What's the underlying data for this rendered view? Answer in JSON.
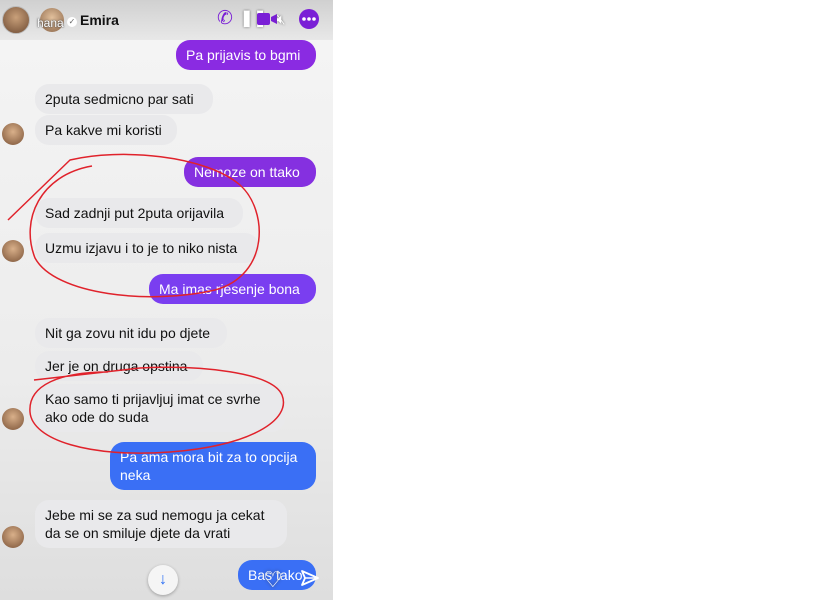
{
  "story": {
    "username": "hana",
    "contact_name": "Emira"
  },
  "icons": {
    "call": "phone-icon",
    "video": "video-icon",
    "mute": "mute-icon",
    "more": "more-icon",
    "pause": "pause-icon",
    "scroll_down": "arrow-down-icon",
    "like": "heart-icon",
    "share": "send-icon"
  },
  "colors": {
    "outgoing_purple": "#8a2be2",
    "outgoing_blue": "#3a6ff5",
    "annotation_red": "#e0222b"
  },
  "messages": [
    {
      "side": "out",
      "text": "Pa prijavis to bgmi"
    },
    {
      "side": "in",
      "text": "2puta sedmicno par sati"
    },
    {
      "side": "in",
      "text": "Pa kakve mi koristi"
    },
    {
      "side": "out",
      "text": "Nemoze on ttako"
    },
    {
      "side": "in",
      "text": "Sad zadnji put 2puta orijavila"
    },
    {
      "side": "in",
      "text": "Uzmu izjavu i to je to niko nista"
    },
    {
      "side": "out",
      "text": "Ma imas rjesenje bona"
    },
    {
      "side": "in",
      "text": "Nit ga zovu nit idu po djete"
    },
    {
      "side": "in",
      "text": "Jer je on druga opstina"
    },
    {
      "side": "in",
      "lines": [
        "Kao samo ti prijavljuj imat ce svrhe",
        "ako ode do suda"
      ]
    },
    {
      "side": "out",
      "lines": [
        "Pa ama mora bit za to opcija",
        "neka"
      ]
    },
    {
      "side": "in",
      "lines": [
        "Jebe mi se za sud nemogu ja cekat",
        "da se on smiluje djete da vrati"
      ]
    },
    {
      "side": "out",
      "text": "Bas tako"
    }
  ]
}
